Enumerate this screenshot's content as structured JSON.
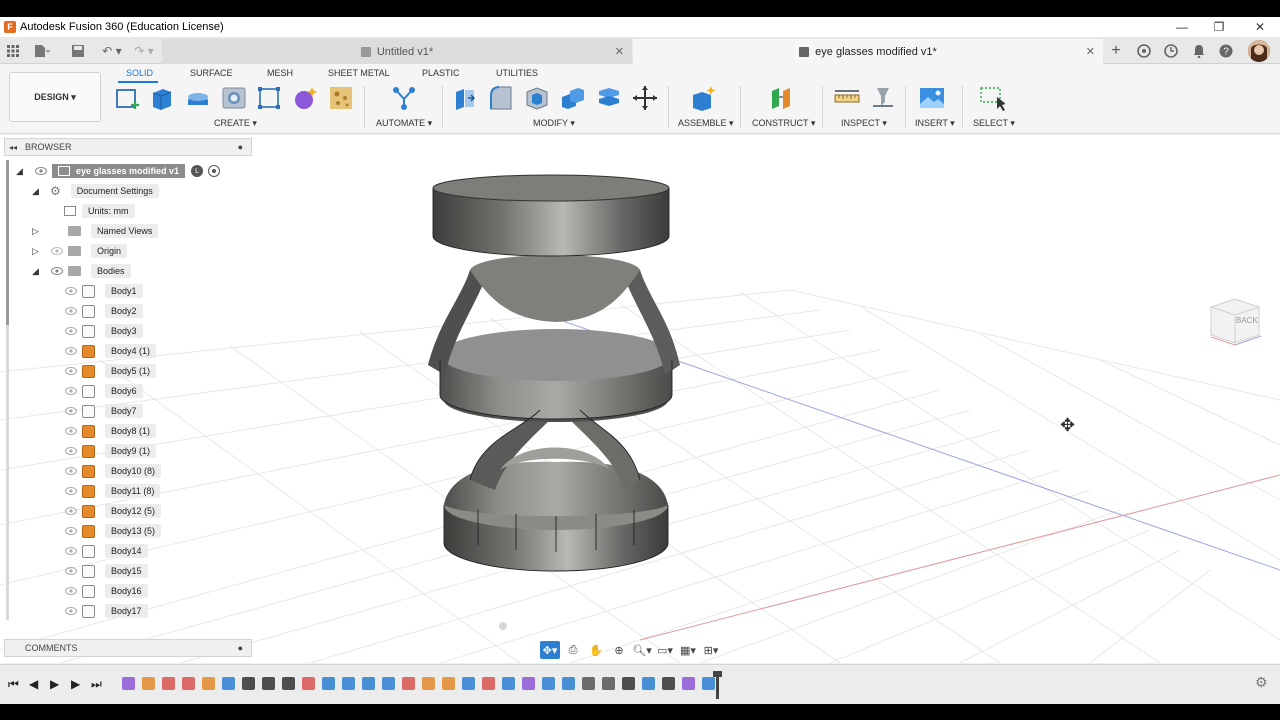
{
  "window": {
    "title": "Autodesk Fusion 360 (Education License)",
    "minimize": "—",
    "restore": "❐",
    "close": "✕"
  },
  "tabs": {
    "inactive_label": "Untitled v1*",
    "active_label": "eye glasses modified v1*",
    "close_glyph": "✕"
  },
  "ribbon": {
    "workspace_button": "DESIGN ▾",
    "tabs": [
      "SOLID",
      "SURFACE",
      "MESH",
      "SHEET METAL",
      "PLASTIC",
      "UTILITIES"
    ],
    "groups": [
      "CREATE ▾",
      "AUTOMATE ▾",
      "MODIFY ▾",
      "ASSEMBLE ▾",
      "CONSTRUCT ▾",
      "INSPECT ▾",
      "INSERT ▾",
      "SELECT ▾"
    ]
  },
  "browser": {
    "title": "BROWSER",
    "root": "eye glasses modified v1",
    "items": {
      "document_settings": "Document Settings",
      "units": "Units: mm",
      "named_views": "Named Views",
      "origin": "Origin",
      "bodies": "Bodies"
    },
    "bodies": [
      {
        "label": "Body1",
        "kind": "plain"
      },
      {
        "label": "Body2",
        "kind": "plain"
      },
      {
        "label": "Body3",
        "kind": "plain"
      },
      {
        "label": "Body4 (1)",
        "kind": "comp"
      },
      {
        "label": "Body5 (1)",
        "kind": "comp"
      },
      {
        "label": "Body6",
        "kind": "plain"
      },
      {
        "label": "Body7",
        "kind": "plain"
      },
      {
        "label": "Body8 (1)",
        "kind": "comp"
      },
      {
        "label": "Body9 (1)",
        "kind": "comp"
      },
      {
        "label": "Body10 (8)",
        "kind": "comp"
      },
      {
        "label": "Body11 (8)",
        "kind": "comp"
      },
      {
        "label": "Body12 (5)",
        "kind": "comp"
      },
      {
        "label": "Body13 (5)",
        "kind": "comp"
      },
      {
        "label": "Body14",
        "kind": "plain"
      },
      {
        "label": "Body15",
        "kind": "plain"
      },
      {
        "label": "Body16",
        "kind": "plain"
      },
      {
        "label": "Body17",
        "kind": "plain"
      }
    ]
  },
  "comments": {
    "title": "COMMENTS"
  },
  "viewcube": {
    "face_label": "BACK"
  },
  "colors": {
    "accent": "#1a73e8",
    "component_body": "#e48a2a",
    "body_model": "#6e6e6c"
  }
}
